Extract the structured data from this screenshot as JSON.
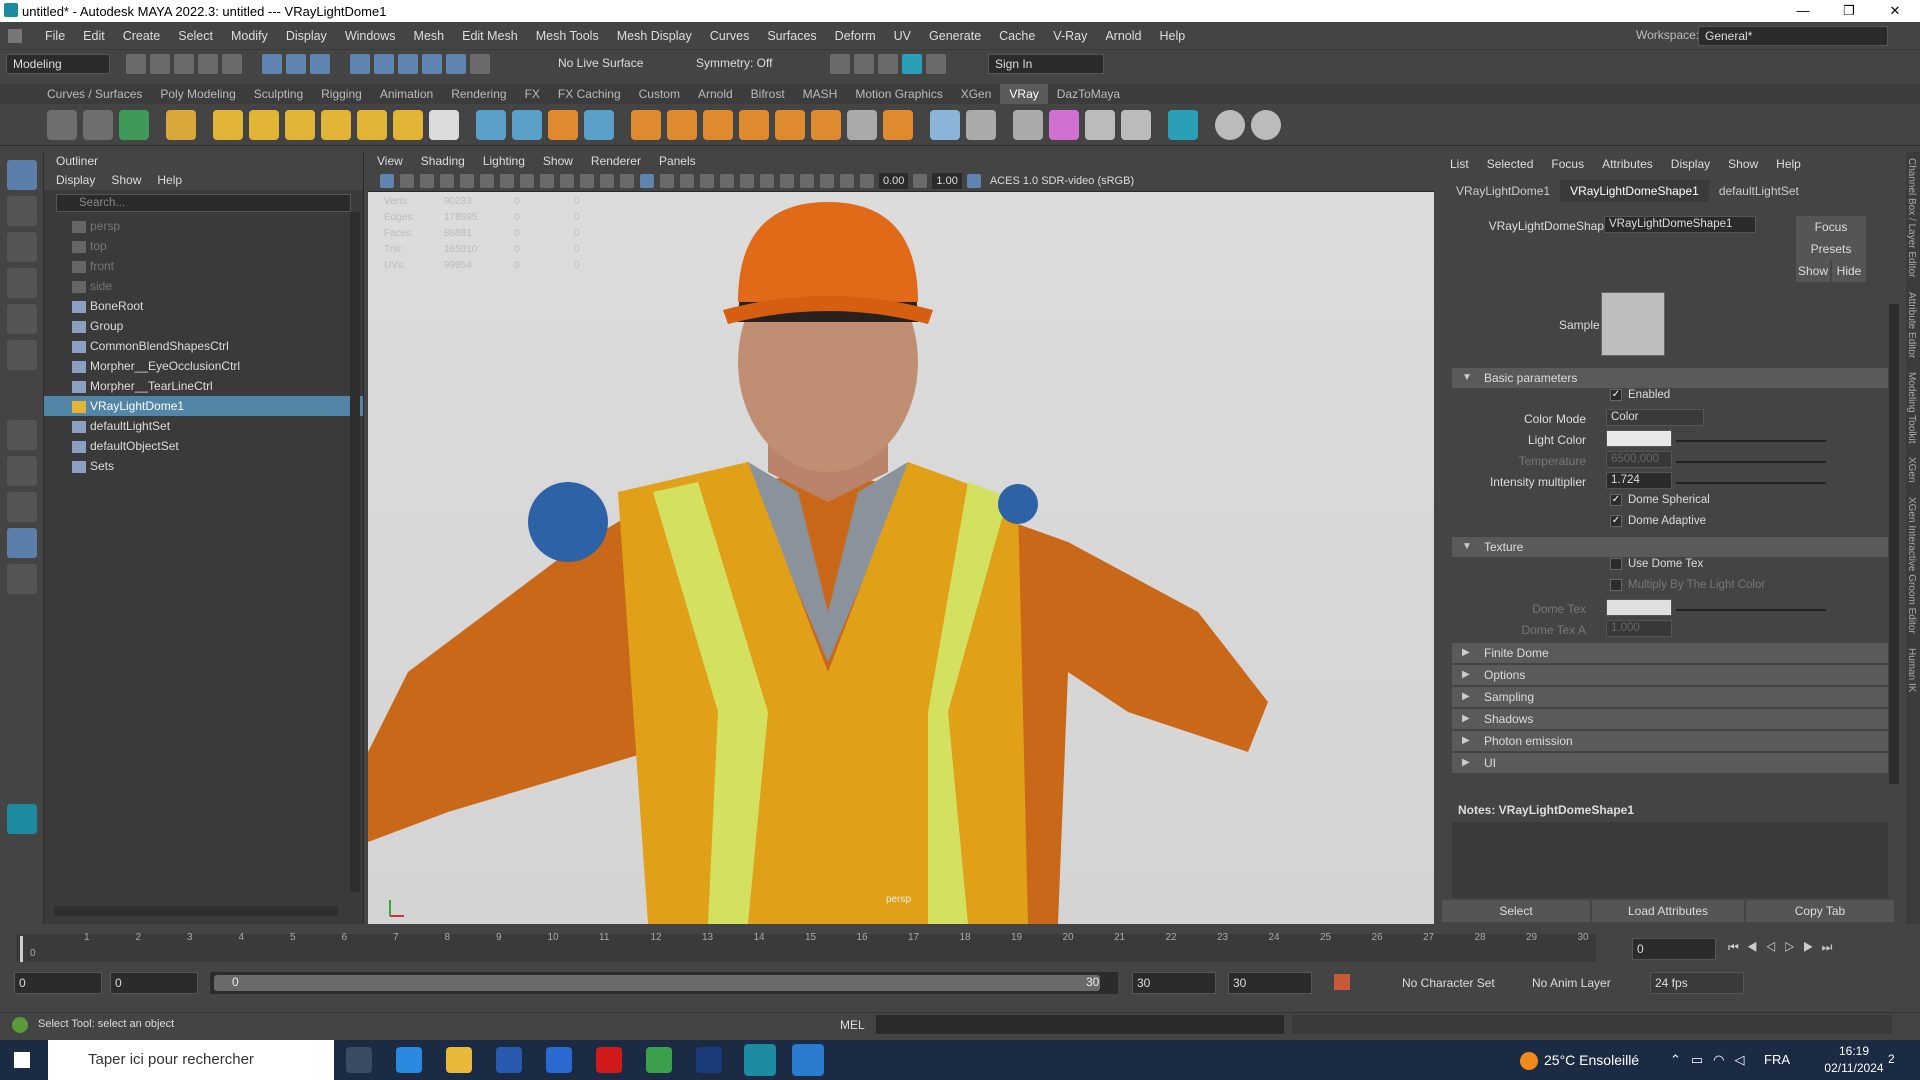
{
  "window": {
    "title": "untitled* - Autodesk MAYA 2022.3: untitled  ---  VRayLightDome1",
    "min": "—",
    "max": "❐",
    "close": "✕"
  },
  "menubar": {
    "items": [
      "File",
      "Edit",
      "Create",
      "Select",
      "Modify",
      "Display",
      "Windows",
      "Mesh",
      "Edit Mesh",
      "Mesh Tools",
      "Mesh Display",
      "Curves",
      "Surfaces",
      "Deform",
      "UV",
      "Generate",
      "Cache",
      "V-Ray",
      "Arnold",
      "Help"
    ],
    "workspace_label": "Workspace:",
    "workspace_value": "General*"
  },
  "statusline": {
    "mode": "Modeling",
    "live_surface": "No Live Surface",
    "symmetry": "Symmetry: Off",
    "sign_in": "Sign In"
  },
  "shelf": {
    "tabs": [
      "Curves / Surfaces",
      "Poly Modeling",
      "Sculpting",
      "Rigging",
      "Animation",
      "Rendering",
      "FX",
      "FX Caching",
      "Custom",
      "Arnold",
      "Bifrost",
      "MASH",
      "Motion Graphics",
      "XGen",
      "VRay",
      "DazToMaya"
    ],
    "active": "VRay"
  },
  "outliner": {
    "title": "Outliner",
    "menu": [
      "Display",
      "Show",
      "Help"
    ],
    "search_placeholder": "Search...",
    "items": [
      {
        "label": "persp",
        "dim": true
      },
      {
        "label": "top",
        "dim": true
      },
      {
        "label": "front",
        "dim": true
      },
      {
        "label": "side",
        "dim": true
      },
      {
        "label": "BoneRoot"
      },
      {
        "label": "Group"
      },
      {
        "label": "CommonBlendShapesCtrl"
      },
      {
        "label": "Morpher__EyeOcclusionCtrl"
      },
      {
        "label": "Morpher__TearLineCtrl"
      },
      {
        "label": "VRayLightDome1",
        "selected": true
      },
      {
        "label": "defaultLightSet"
      },
      {
        "label": "defaultObjectSet"
      },
      {
        "label": "Sets"
      }
    ]
  },
  "viewport": {
    "menu": [
      "View",
      "Shading",
      "Lighting",
      "Show",
      "Renderer",
      "Panels"
    ],
    "exposure": "0.00",
    "gamma": "1.00",
    "color_space": "ACES 1.0 SDR-video (sRGB)",
    "camera": "persp",
    "hud": [
      {
        "label": "Verts:",
        "a": "90233",
        "b": "0",
        "c": "0"
      },
      {
        "label": "Edges:",
        "a": "178995",
        "b": "0",
        "c": "0"
      },
      {
        "label": "Faces:",
        "a": "88881",
        "b": "0",
        "c": "0"
      },
      {
        "label": "Tris:",
        "a": "165010",
        "b": "0",
        "c": "0"
      },
      {
        "label": "UVs:",
        "a": "99954",
        "b": "0",
        "c": "0"
      }
    ]
  },
  "attr": {
    "menu": [
      "List",
      "Selected",
      "Focus",
      "Attributes",
      "Display",
      "Show",
      "Help"
    ],
    "tabs": [
      "VRayLightDome1",
      "VRayLightDomeShape1",
      "defaultLightSet"
    ],
    "active_tab": "VRayLightDomeShape1",
    "shape_label": "VRayLightDomeShape:",
    "shape_value": "VRayLightDomeShape1",
    "focus": "Focus",
    "presets": "Presets",
    "show": "Show",
    "hide": "Hide",
    "sample": "Sample",
    "basic": "Basic parameters",
    "enabled": "Enabled",
    "color_mode_label": "Color Mode",
    "color_mode": "Color",
    "light_color": "Light Color",
    "temperature_label": "Temperature",
    "temperature": "6500.000",
    "intensity_label": "Intensity multiplier",
    "intensity": "1.724",
    "dome_spherical": "Dome Spherical",
    "dome_adaptive": "Dome Adaptive",
    "texture": "Texture",
    "use_dome_tex": "Use Dome Tex",
    "multiply": "Multiply By The Light Color",
    "dome_tex": "Dome Tex",
    "dome_tex_a": "Dome Tex A",
    "dome_tex_a_val": "1.000",
    "collapsed": [
      "Finite Dome",
      "Options",
      "Sampling",
      "Shadows",
      "Photon emission",
      "UI"
    ],
    "notes": "Notes:  VRayLightDomeShape1",
    "select": "Select",
    "load": "Load Attributes",
    "copy": "Copy Tab",
    "side_tabs": [
      "Channel Box / Layer Editor",
      "Attribute Editor",
      "Modeling Toolkit",
      "XGen",
      "XGen Interactive Groom Editor",
      "Human IK"
    ]
  },
  "timeslider": {
    "ticks": [
      "1",
      "2",
      "3",
      "4",
      "5",
      "6",
      "7",
      "8",
      "9",
      "10",
      "11",
      "12",
      "13",
      "14",
      "15",
      "16",
      "17",
      "18",
      "19",
      "20",
      "21",
      "22",
      "23",
      "24",
      "25",
      "26",
      "27",
      "28",
      "29",
      "30"
    ],
    "start_tick": "0",
    "current": "0"
  },
  "range": {
    "start": "0",
    "anim_start": "0",
    "range_start": "0",
    "range_end": "30",
    "anim_end": "30",
    "end": "30",
    "char_set": "No Character Set",
    "anim_layer": "No Anim Layer",
    "fps": "24 fps"
  },
  "cmd": {
    "help": "Select Tool: select an object",
    "mel": "MEL"
  },
  "taskbar": {
    "search": "Taper ici pour rechercher",
    "weather": "25°C  Ensoleillé",
    "lang": "FRA",
    "time": "16:19",
    "date": "02/11/2024",
    "notif": "2"
  }
}
